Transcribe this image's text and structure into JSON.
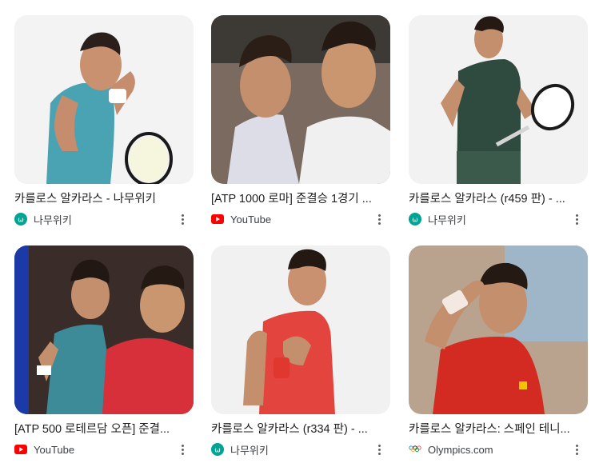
{
  "results": [
    {
      "title": "카를로스 알카라스 - 나무위키",
      "source": "나무위키",
      "source_icon": "namuwiki-icon"
    },
    {
      "title": "[ATP 1000 로마] 준결승 1경기 ...",
      "source": "YouTube",
      "source_icon": "youtube-icon"
    },
    {
      "title": "카를로스 알카라스 (r459 판) - ...",
      "source": "나무위키",
      "source_icon": "namuwiki-icon"
    },
    {
      "title": "[ATP 500 로테르담 오픈] 준결...",
      "source": "YouTube",
      "source_icon": "youtube-icon"
    },
    {
      "title": "카를로스 알카라스 (r334 판) - ...",
      "source": "나무위키",
      "source_icon": "namuwiki-icon"
    },
    {
      "title": "카를로스 알카라스: 스페인 테니...",
      "source": "Olympics.com",
      "source_icon": "olympic-rings-icon"
    }
  ],
  "colors": {
    "youtube_red": "#ff0000",
    "namuwiki_green": "#00a495",
    "dots": "#5f6368"
  }
}
